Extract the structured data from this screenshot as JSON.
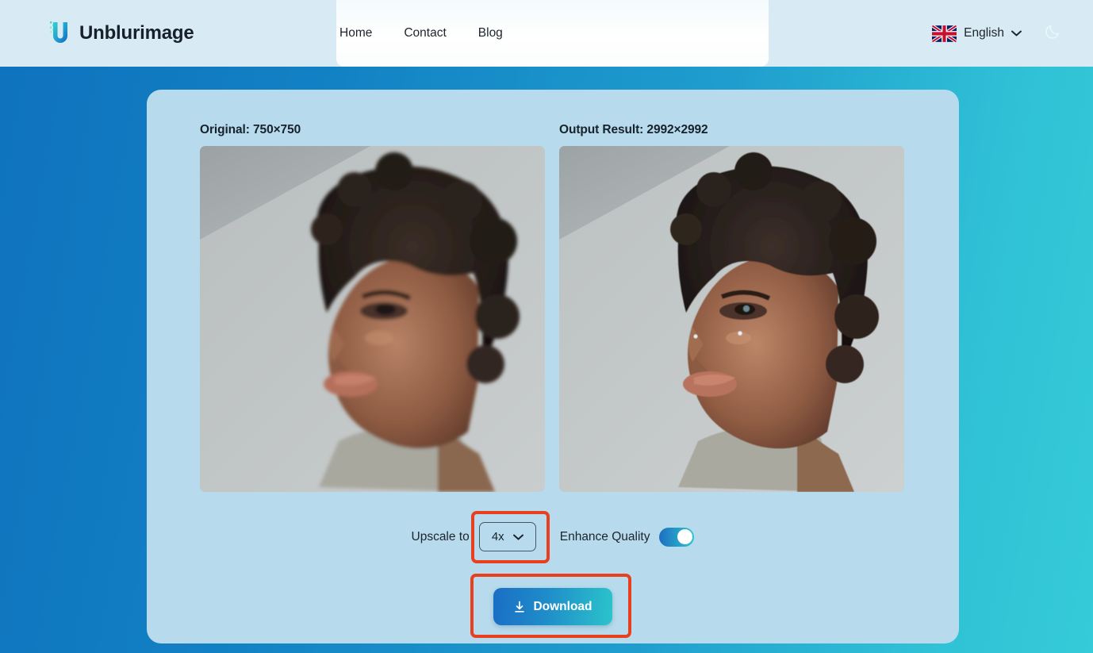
{
  "header": {
    "brand": {
      "name": "Unblurimage",
      "logo_icon": "unblurimage-u-logo"
    },
    "nav": [
      {
        "label": "Home"
      },
      {
        "label": "Contact"
      },
      {
        "label": "Blog"
      }
    ],
    "language": {
      "label": "English",
      "flag_icon": "uk-flag-icon",
      "chevron_icon": "chevron-down-icon"
    },
    "theme_toggle": {
      "icon": "moon-icon"
    }
  },
  "main": {
    "original": {
      "label": "Original: 750×750",
      "image_alt": "portrait-of-woman-in-profile"
    },
    "output": {
      "label": "Output Result: 2992×2992",
      "image_alt": "portrait-of-woman-in-profile-upscaled"
    },
    "controls": {
      "upscale_label": "Upscale to",
      "upscale_value": "4x",
      "upscale_chevron_icon": "chevron-down-icon",
      "enhance_label": "Enhance Quality",
      "enhance_enabled": "on"
    },
    "download": {
      "label": "Download",
      "icon": "download-arrow-icon"
    }
  },
  "colors": {
    "page_gradient_start": "#0f72bd",
    "page_gradient_end": "#35cbd8",
    "header_bg": "#d8eaf3",
    "card_bg": "#b7dbec",
    "accent_blue": "#1a6ec4",
    "accent_teal": "#2bc4cb",
    "highlight_red": "#e8401f",
    "text_dark": "#18222c"
  },
  "highlights": [
    {
      "name": "upscale-select-highlight"
    },
    {
      "name": "download-button-highlight"
    }
  ]
}
